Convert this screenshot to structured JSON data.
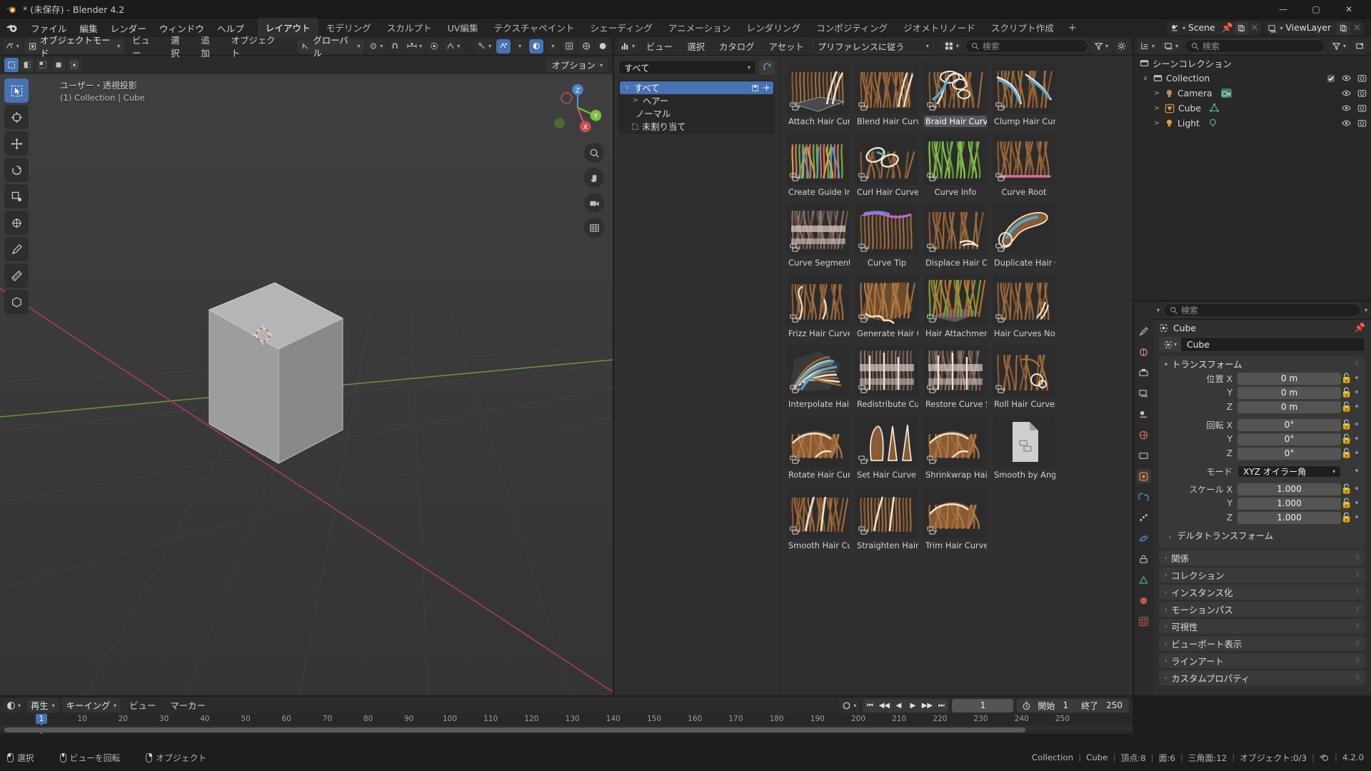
{
  "window": {
    "title": "* (未保存) - Blender 4.2",
    "minimize": "—",
    "maximize": "▢",
    "close": "✕"
  },
  "topbar": {
    "menus": [
      "ファイル",
      "編集",
      "レンダー",
      "ウィンドウ",
      "ヘルプ"
    ],
    "workspaces": [
      "レイアウト",
      "モデリング",
      "スカルプト",
      "UV編集",
      "テクスチャペイント",
      "シェーディング",
      "アニメーション",
      "レンダリング",
      "コンポジティング",
      "ジオメトリノード",
      "スクリプト作成"
    ],
    "active_workspace": "レイアウト",
    "add_workspace": "+",
    "scene_name": "Scene",
    "viewlayer_name": "ViewLayer"
  },
  "viewport": {
    "mode": "オブジェクトモード",
    "menus": [
      "ビュー",
      "選択",
      "追加",
      "オブジェクト"
    ],
    "orientation": "グローバル",
    "options_label": "オプション",
    "overlay_text_line1": "ユーザー・透視投影",
    "overlay_text_line2": "(1) Collection | Cube",
    "gizmo_axes": [
      "X",
      "Y",
      "Z"
    ]
  },
  "asset_browser": {
    "menus": [
      "ビュー",
      "選択",
      "カタログ",
      "アセット"
    ],
    "display_mode": "プリファレンスに従う",
    "search_placeholder": "検索",
    "library": "すべて",
    "catalog_tree": [
      {
        "label": "すべて",
        "level": 0,
        "selected": true,
        "expander": "v"
      },
      {
        "label": "ヘアー",
        "level": 1,
        "selected": false,
        "expander": ">"
      },
      {
        "label": "ノーマル",
        "level": 1,
        "selected": false,
        "expander": ""
      },
      {
        "label": "未割り当て",
        "level": 1,
        "selected": false,
        "expander": ""
      }
    ],
    "assets": [
      {
        "label": "Attach Hair Curv...",
        "kind": "hair-strands",
        "selected": false
      },
      {
        "label": "Blend Hair Curves",
        "kind": "hair-dense",
        "selected": false
      },
      {
        "label": "Braid Hair Curves",
        "kind": "hair-braid",
        "selected": true
      },
      {
        "label": "Clump Hair Curves",
        "kind": "hair-clump",
        "selected": false
      },
      {
        "label": "Create Guide Ind...",
        "kind": "hair-colored",
        "selected": false
      },
      {
        "label": "Curl Hair Curves",
        "kind": "hair-curl",
        "selected": false
      },
      {
        "label": "Curve Info",
        "kind": "hair-green",
        "selected": false
      },
      {
        "label": "Curve Root",
        "kind": "hair-root",
        "selected": false
      },
      {
        "label": "Curve Segment",
        "kind": "hair-segment",
        "selected": false
      },
      {
        "label": "Curve Tip",
        "kind": "hair-tip",
        "selected": false
      },
      {
        "label": "Displace Hair Cur...",
        "kind": "hair-displace",
        "selected": false
      },
      {
        "label": "Duplicate Hair C...",
        "kind": "hair-duplicate",
        "selected": false
      },
      {
        "label": "Frizz Hair Curves",
        "kind": "hair-frizz",
        "selected": false
      },
      {
        "label": "Generate Hair Cu...",
        "kind": "hair-generate",
        "selected": false
      },
      {
        "label": "Hair Attachment ...",
        "kind": "hair-attach",
        "selected": false
      },
      {
        "label": "Hair Curves Noise",
        "kind": "hair-noise",
        "selected": false
      },
      {
        "label": "Interpolate Hair ...",
        "kind": "hair-interpolate",
        "selected": false
      },
      {
        "label": "Redistribute Cur...",
        "kind": "hair-redistribute",
        "selected": false
      },
      {
        "label": "Restore Curve Se...",
        "kind": "hair-restore",
        "selected": false
      },
      {
        "label": "Roll Hair Curves",
        "kind": "hair-roll",
        "selected": false
      },
      {
        "label": "Rotate Hair Curves",
        "kind": "hair-rotate",
        "selected": false
      },
      {
        "label": "Set Hair Curve Pr...",
        "kind": "hair-profile",
        "selected": false
      },
      {
        "label": "Shrinkwrap Hair ...",
        "kind": "hair-shrinkwrap",
        "selected": false
      },
      {
        "label": "Smooth by Angle",
        "kind": "file-blank",
        "selected": false
      },
      {
        "label": "Smooth Hair Cur...",
        "kind": "hair-smooth",
        "selected": false
      },
      {
        "label": "Straighten Hair C...",
        "kind": "hair-straighten",
        "selected": false
      },
      {
        "label": "Trim Hair Curves",
        "kind": "hair-trim",
        "selected": false
      }
    ]
  },
  "outliner": {
    "search_placeholder": "検索",
    "rows": [
      {
        "label": "シーンコレクション",
        "level": 0,
        "expander": "",
        "icon": "collection-icon",
        "has_check": false,
        "has_eye": false,
        "has_cam": false
      },
      {
        "label": "Collection",
        "level": 1,
        "expander": "v",
        "icon": "collection-icon",
        "has_check": true,
        "has_eye": true,
        "has_cam": true
      },
      {
        "label": "Camera",
        "level": 2,
        "expander": ">",
        "icon": "camera-icon",
        "has_check": false,
        "has_eye": true,
        "has_cam": true
      },
      {
        "label": "Cube",
        "level": 2,
        "expander": ">",
        "icon": "mesh-icon",
        "has_check": false,
        "has_eye": true,
        "has_cam": true
      },
      {
        "label": "Light",
        "level": 2,
        "expander": ">",
        "icon": "light-icon",
        "has_check": false,
        "has_eye": true,
        "has_cam": true
      }
    ]
  },
  "properties": {
    "search_placeholder": "検索",
    "breadcrumb": "Cube",
    "object_name": "Cube",
    "transform": {
      "title": "トランスフォーム",
      "location_label": "位置 X",
      "rows": [
        {
          "label": "位置 X",
          "value": "0 m"
        },
        {
          "label": "Y",
          "value": "0 m"
        },
        {
          "label": "Z",
          "value": "0 m"
        }
      ],
      "rotation_rows": [
        {
          "label": "回転 X",
          "value": "0°"
        },
        {
          "label": "Y",
          "value": "0°"
        },
        {
          "label": "Z",
          "value": "0°"
        }
      ],
      "mode_label": "モード",
      "mode_value": "XYZ オイラー角",
      "scale_rows": [
        {
          "label": "スケール X",
          "value": "1.000"
        },
        {
          "label": "Y",
          "value": "1.000"
        },
        {
          "label": "Z",
          "value": "1.000"
        }
      ],
      "delta_label": "デルタトランスフォーム"
    },
    "collapsed_panels": [
      "関係",
      "コレクション",
      "インスタンス化",
      "モーションパス",
      "可視性",
      "ビューポート表示",
      "ラインアート",
      "カスタムプロパティ"
    ]
  },
  "timeline": {
    "menus": [
      "再生",
      "キーイング",
      "ビュー",
      "マーカー"
    ],
    "current_frame": "1",
    "start_label": "開始",
    "start_value": "1",
    "end_label": "終了",
    "end_value": "250",
    "ticks": [
      "10",
      "20",
      "30",
      "40",
      "50",
      "60",
      "70",
      "80",
      "90",
      "100",
      "110",
      "120",
      "130",
      "140",
      "150",
      "160",
      "170",
      "180",
      "190",
      "200",
      "210",
      "220",
      "230",
      "240",
      "250"
    ],
    "playhead_frame": "1"
  },
  "statusbar": {
    "hints": [
      {
        "button": "left",
        "label": "選択"
      },
      {
        "button": "middle",
        "label": "ビューを回転"
      },
      {
        "button": "right",
        "label": "オブジェクト"
      }
    ],
    "scene_stats": [
      "Collection",
      "Cube",
      "頂点:8",
      "面:6",
      "三角面:12",
      "オブジェクト:0/3"
    ],
    "version": "4.2.0"
  }
}
